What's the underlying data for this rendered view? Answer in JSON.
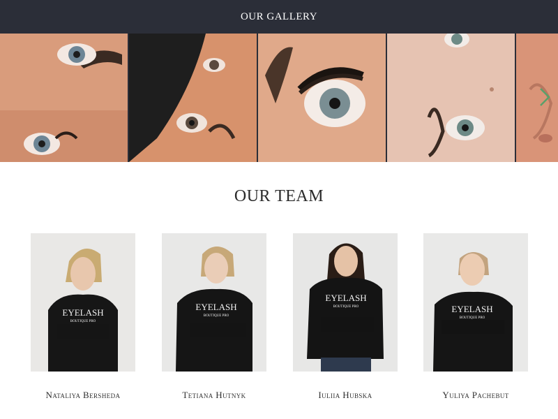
{
  "header": {
    "title": "OUR GALLERY"
  },
  "gallery": {
    "photos": [
      {
        "name": "eye-closeup-1"
      },
      {
        "name": "eye-closeup-2"
      },
      {
        "name": "eye-closeup-3"
      },
      {
        "name": "eye-closeup-4"
      },
      {
        "name": "eye-closeup-5"
      }
    ],
    "next_icon": "chevron-right-icon"
  },
  "team": {
    "title": "OUR TEAM",
    "members": [
      {
        "name": "Nataliya Bersheda"
      },
      {
        "name": "Tetiana Hutnyk"
      },
      {
        "name": "Iuliia Hubska"
      },
      {
        "name": "Yuliya Pachebut"
      }
    ],
    "shirt_logo_line1": "EYELASH",
    "shirt_logo_line2": "BOUTIQUE PRO"
  },
  "colors": {
    "header_bg": "#2b2e38",
    "accent_arrow": "#5aa06a"
  }
}
